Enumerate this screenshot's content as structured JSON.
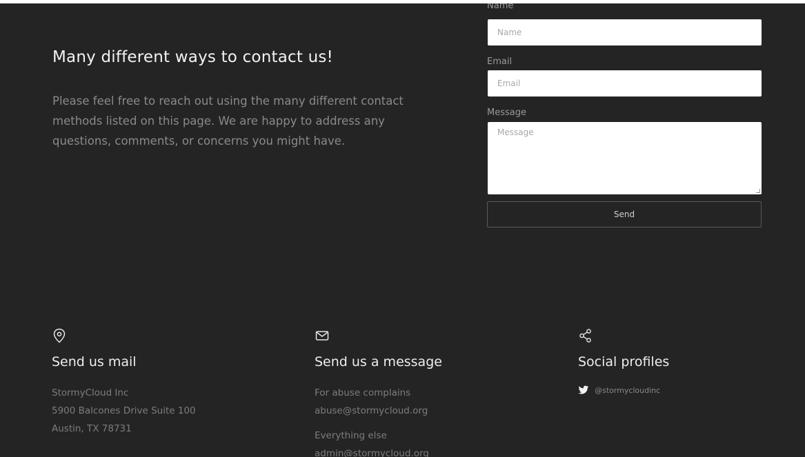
{
  "intro": {
    "title": "Many different ways to contact us!",
    "text": "Please feel free to reach out using the many different contact methods listed on this page. We are happy to address any questions, comments, or concerns you might have."
  },
  "form": {
    "name_label": "Name",
    "name_placeholder": "Name",
    "email_label": "Email",
    "email_placeholder": "Email",
    "message_label": "Message",
    "message_placeholder": "Message",
    "send_label": "Send"
  },
  "mail": {
    "icon": "map-pin-icon",
    "title": "Send us mail",
    "lines": [
      "StormyCloud Inc",
      "5900 Balcones Drive Suite 100",
      "Austin, TX 78731"
    ]
  },
  "message": {
    "icon": "envelope-icon",
    "title": "Send us a message",
    "abuse_label": "For abuse complains",
    "abuse_email": "abuse@stormycloud.org",
    "else_label": "Everything else",
    "else_email": "admin@stormycloud.org"
  },
  "social": {
    "icon": "share-icon",
    "title": "Social profiles",
    "twitter_icon": "twitter-icon",
    "twitter_handle": "@stormycloudinc"
  },
  "colors": {
    "background": "#242424",
    "text_primary": "#f2f2f2",
    "text_muted": "#8a8a8a"
  }
}
